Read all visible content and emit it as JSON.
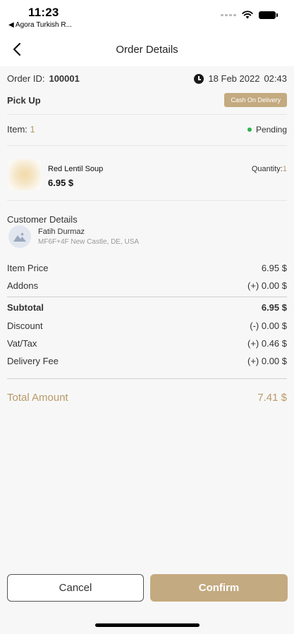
{
  "status_bar": {
    "time": "11:23",
    "back_to_app": "◀ Agora Turkish R..."
  },
  "nav": {
    "title": "Order Details",
    "back_icon": "chevron-left-icon"
  },
  "order": {
    "id_label": "Order ID:",
    "id_value": "100001",
    "date": "18 Feb 2022",
    "time": "02:43",
    "type": "Pick Up",
    "payment_badge": "Cash On Delivery",
    "item_label": "Item:",
    "item_count": "1",
    "status": "Pending"
  },
  "item": {
    "name": "Red Lentil Soup",
    "price": "6.95 $",
    "quantity_label": "Quantity:",
    "quantity_value": "1"
  },
  "customer": {
    "section_title": "Customer Details",
    "name": "Fatih Durmaz",
    "address": "MF6F+4F New Castle, DE, USA"
  },
  "summary": {
    "item_price_label": "Item Price",
    "item_price": "6.95 $",
    "addons_label": "Addons",
    "addons": "(+) 0.00 $",
    "subtotal_label": "Subtotal",
    "subtotal": "6.95 $",
    "discount_label": "Discount",
    "discount": "(-) 0.00 $",
    "tax_label": "Vat/Tax",
    "tax": "(+) 0.46 $",
    "delivery_label": "Delivery Fee",
    "delivery": "(+) 0.00 $",
    "total_label": "Total Amount",
    "total": "7.41 $"
  },
  "actions": {
    "cancel_label": "Cancel",
    "confirm_label": "Confirm"
  },
  "colors": {
    "accent": "#c4aa80",
    "status_green": "#2cb34a"
  }
}
